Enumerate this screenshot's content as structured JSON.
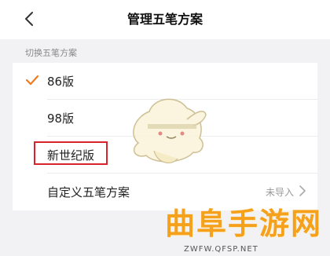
{
  "header": {
    "title": "管理五笔方案",
    "back_icon": "chevron-left-icon"
  },
  "section": {
    "label": "切换五笔方案"
  },
  "schemes": [
    {
      "label": "86版",
      "selected": true
    },
    {
      "label": "98版",
      "selected": false
    },
    {
      "label": "新世纪版",
      "selected": false
    }
  ],
  "custom": {
    "label": "自定义五笔方案",
    "status": "未导入",
    "icon": "chevron-right-icon"
  },
  "colors": {
    "accent": "#f07b1f",
    "highlight": "#d8232a",
    "watermark": "#f6a11b"
  },
  "watermark": {
    "logo_text": "曲阜手游网",
    "url": "ZWFW.QFSP.NET"
  }
}
